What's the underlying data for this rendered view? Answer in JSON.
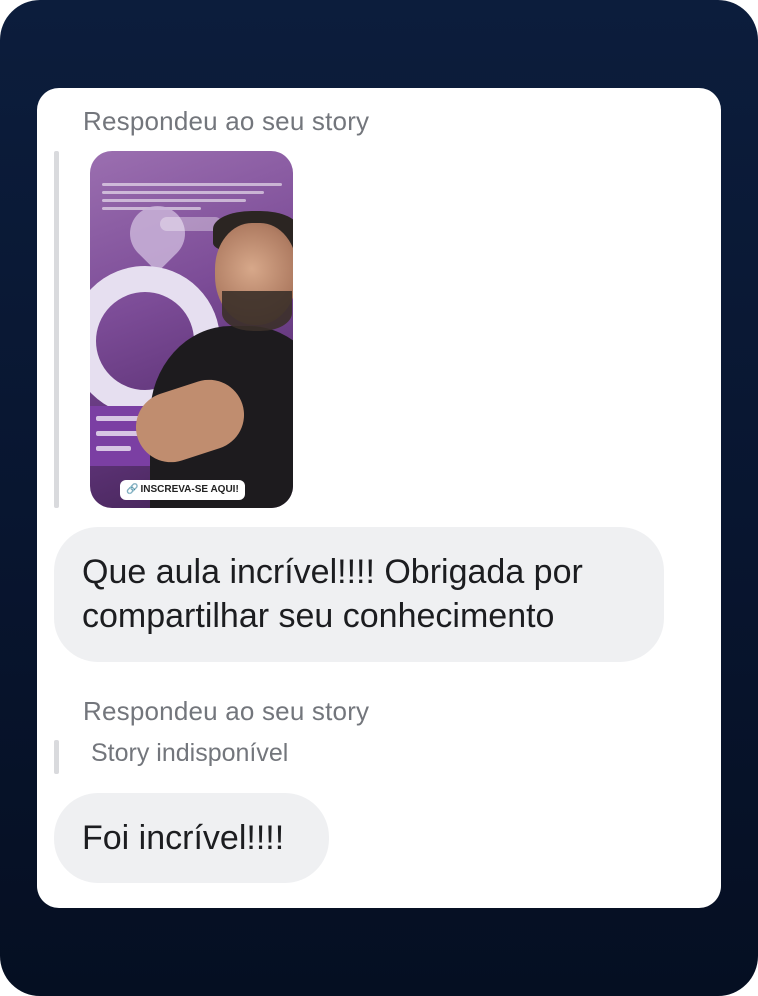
{
  "conversation": {
    "message_1": {
      "reply_label": "Respondeu ao seu story",
      "story_sticker": "INSCREVA-SE AQUI!",
      "text": "Que aula incrível!!!! Obrigada por compartilhar seu conhecimento"
    },
    "message_2": {
      "reply_label": "Respondeu ao seu story",
      "story_status": "Story indisponível",
      "text": "Foi incrível!!!!"
    }
  },
  "colors": {
    "background_frame": "#0c1d3c",
    "card": "#ffffff",
    "bubble": "#eff0f2",
    "muted_text": "#73767c",
    "quote_bar": "#d9dadd"
  },
  "icons": {
    "sticker_link": "link-icon"
  }
}
